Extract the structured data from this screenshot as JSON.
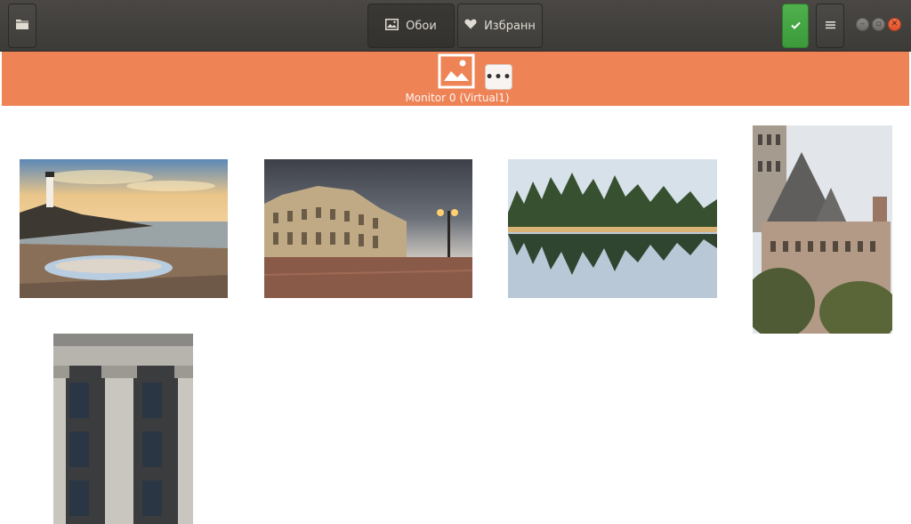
{
  "headerbar": {
    "open_icon": "folder-icon",
    "tabs": [
      {
        "label": "Обои",
        "icon": "image-icon"
      },
      {
        "label": "Избранн",
        "icon": "heart-icon"
      }
    ],
    "apply_icon": "checkmark-icon",
    "menu_icon": "hamburger-menu-icon",
    "window_controls": [
      "minimize",
      "maximize",
      "close"
    ]
  },
  "monitor": {
    "label": "Monitor 0 (Virtual1)",
    "icon": "image-icon",
    "more_icon": "ellipsis-icon",
    "bar_color": "#ee8356"
  },
  "wallpapers": [
    {
      "name": "Lighthouse at sunset"
    },
    {
      "name": "Royal palace at dusk"
    },
    {
      "name": "Forest lake reflection"
    },
    {
      "name": "Castle tower"
    },
    {
      "name": "Classical columns facade"
    }
  ],
  "colors": {
    "accent": "#ee8356",
    "apply_green": "#4fb04c",
    "close_red": "#e0512a",
    "headerbar": "#3c3b37"
  }
}
